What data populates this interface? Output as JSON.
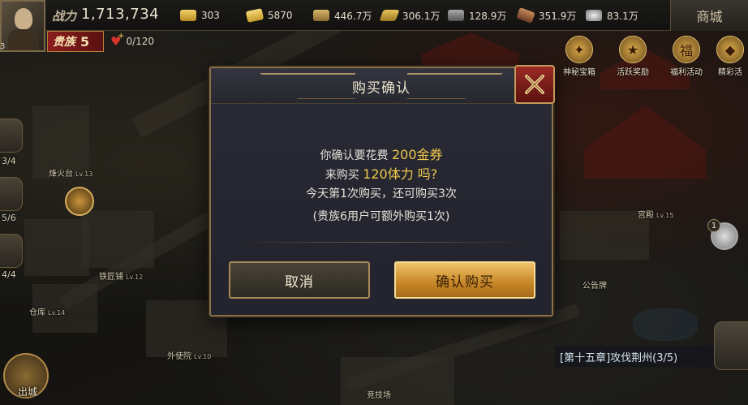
{
  "topbar": {
    "power_label": "战力",
    "power_value": "1,713,734",
    "resources": [
      {
        "icon": "gold-ingot-icon",
        "value": "303"
      },
      {
        "icon": "coupon-icon",
        "value": "5870"
      },
      {
        "icon": "grain-icon",
        "value": "446.7万"
      },
      {
        "icon": "wood-icon",
        "value": "306.1万"
      },
      {
        "icon": "stone-icon",
        "value": "128.9万"
      },
      {
        "icon": "iron-icon",
        "value": "351.9万"
      },
      {
        "icon": "silver-icon",
        "value": "83.1万"
      }
    ],
    "shop_label": "商城",
    "noble_label": "贵族",
    "noble_level": "5",
    "stamina": "0/120",
    "avatar_level": "3"
  },
  "activities": [
    {
      "label": "神秘宝箱",
      "icon": "treasure-chest-icon"
    },
    {
      "label": "活跃奖励",
      "icon": "reward-icon"
    },
    {
      "label": "福利活动",
      "icon": "welfare-icon"
    },
    {
      "label": "精彩活",
      "icon": "event-icon"
    }
  ],
  "side_counts": [
    "3/4",
    "5/6",
    "4/4"
  ],
  "buildings": [
    {
      "name": "烽火台",
      "level": "Lv.13"
    },
    {
      "name": "铁匠铺",
      "level": "Lv.12"
    },
    {
      "name": "仓库",
      "level": "Lv.14"
    },
    {
      "name": "外使院",
      "level": "Lv.10"
    },
    {
      "name": "竞技场",
      "level": ""
    },
    {
      "name": "宫殿",
      "level": "Lv.15"
    },
    {
      "name": "公告牌",
      "level": ""
    }
  ],
  "out_city_label": "出城",
  "quest": "[第十五章]攻伐荆州(3/5)",
  "right_badge": "1",
  "dialog": {
    "title": "购买确认",
    "line1_prefix": "你确认要花费",
    "line1_highlight": "200金券",
    "line2_prefix": "来购买",
    "line2_highlight": "120体力 吗?",
    "line3": "今天第1次购买，还可购买3次",
    "line4": "(贵族6用户可额外购买1次)",
    "cancel_label": "取消",
    "confirm_label": "确认购买"
  }
}
